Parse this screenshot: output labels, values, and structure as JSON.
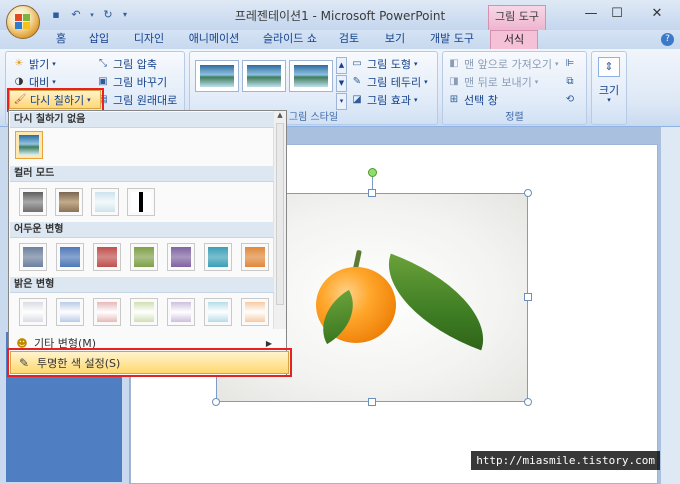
{
  "window": {
    "title": "프레젠테이션1 - Microsoft PowerPoint",
    "context_tool": "그림 도구",
    "minimize": "—",
    "maximize": "☐",
    "close": "✕"
  },
  "qat": [
    "save-icon",
    "undo-icon",
    "redo-icon",
    "customize-icon"
  ],
  "tabs": [
    {
      "label": "홈"
    },
    {
      "label": "삽입"
    },
    {
      "label": "디자인"
    },
    {
      "label": "애니메이션"
    },
    {
      "label": "슬라이드 쇼"
    },
    {
      "label": "검토"
    },
    {
      "label": "보기"
    },
    {
      "label": "개발 도구"
    },
    {
      "label": "서식"
    }
  ],
  "ribbon": {
    "adjust": {
      "brightness": "밝기",
      "contrast": "대비",
      "recolor": "다시 칠하기",
      "compress": "그림 압축",
      "change": "그림 바꾸기",
      "reset": "그림 원래대로"
    },
    "styles": {
      "label": "그림 스타일",
      "shape": "그림 도형",
      "border": "그림 테두리",
      "effects": "그림 효과"
    },
    "arrange": {
      "label": "정렬",
      "front": "맨 앞으로 가져오기",
      "back": "맨 뒤로 보내기",
      "selection": "선택 창"
    },
    "size": {
      "label": "크기"
    }
  },
  "menu": {
    "no_recolor": "다시 칠하기 없음",
    "color_modes": "컬러 모드",
    "dark_variations": "어두운 변형",
    "light_variations": "밝은 변형",
    "more_variations": "기타 변형(M)",
    "set_transparent": "투명한 색 설정(S)"
  },
  "colors": {
    "dark": [
      "#6d7f9e",
      "#4f78b8",
      "#c0504d",
      "#7fa04a",
      "#8064a2",
      "#3aa0b8",
      "#e0893a"
    ],
    "light": [
      "#d9dde4",
      "#b9cbe8",
      "#e6b9b8",
      "#d0e0b2",
      "#cec0dd",
      "#b6dde8",
      "#f7caa4"
    ]
  },
  "watermark": "http://miasmile.tistory.com"
}
